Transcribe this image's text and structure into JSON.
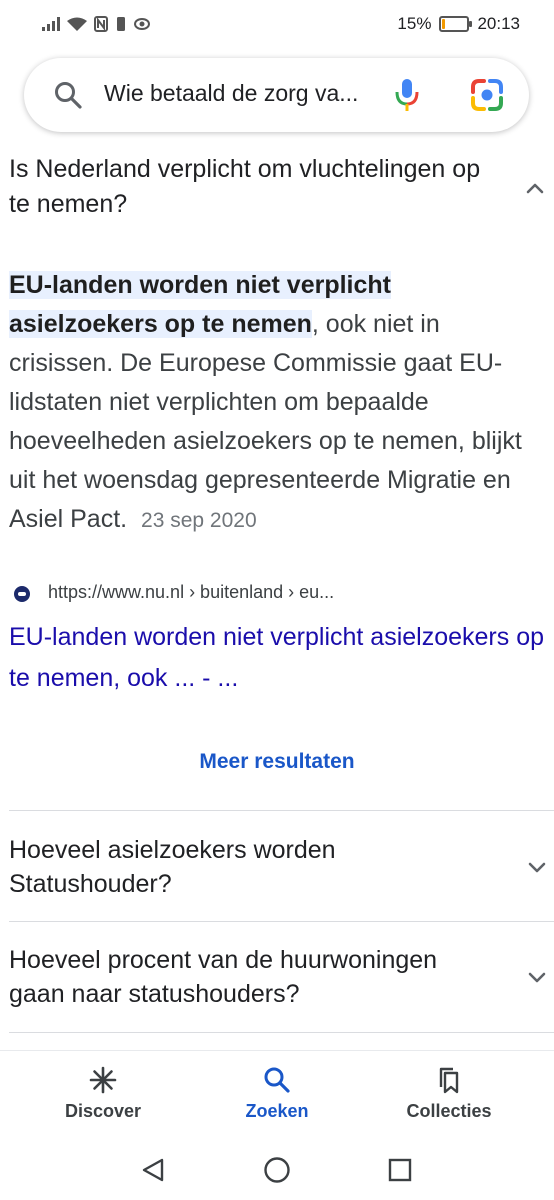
{
  "status_bar": {
    "battery_text": "15%",
    "battery_level": 0.15,
    "battery_color": "#f29900",
    "time": "20:13",
    "icons": [
      "signal-icon",
      "wifi-icon",
      "nfc-icon",
      "vibrate-icon",
      "eye-icon"
    ]
  },
  "search": {
    "query": "Wie betaald de zorg va...",
    "icons": [
      "search-icon",
      "microphone-icon",
      "google-lens-icon"
    ]
  },
  "questions": [
    {
      "text": "Is Nederland verplicht om vluchtelingen op te nemen?",
      "expanded": true,
      "answer": {
        "highlight": "EU-landen worden niet verplicht asielzoekers op te nemen",
        "body": ", ook niet in crisissen. De Europese Commissie gaat EU-lidstaten niet verplichten om bepaalde hoeveelheden asielzoekers op te nemen, blijkt uit het woensdag gepresenteerde Migratie en Asiel Pact.",
        "date": "23 sep 2020"
      },
      "source": {
        "url": "https://www.nu.nl › buitenland › eu...",
        "title": "EU-landen worden niet verplicht asielzoekers op te nemen, ook ... - ..."
      }
    },
    {
      "text": "Hoeveel asielzoekers worden Statushouder?",
      "expanded": false
    },
    {
      "text": "Hoeveel procent van de huurwoningen gaan naar statushouders?",
      "expanded": false
    }
  ],
  "more_results": "Meer resultaten",
  "bottom_nav": [
    {
      "label": "Discover",
      "icon": "discover-asterisk-icon",
      "active": false
    },
    {
      "label": "Zoeken",
      "icon": "search-icon",
      "active": true
    },
    {
      "label": "Collecties",
      "icon": "bookmarks-icon",
      "active": false
    }
  ],
  "colors": {
    "link": "#1a0dab",
    "accent": "#1a57c8",
    "highlight_bg": "#e8f0fe",
    "text": "#202124",
    "secondary": "#70757a"
  },
  "system_nav": [
    "back-icon",
    "home-icon",
    "recents-icon"
  ]
}
